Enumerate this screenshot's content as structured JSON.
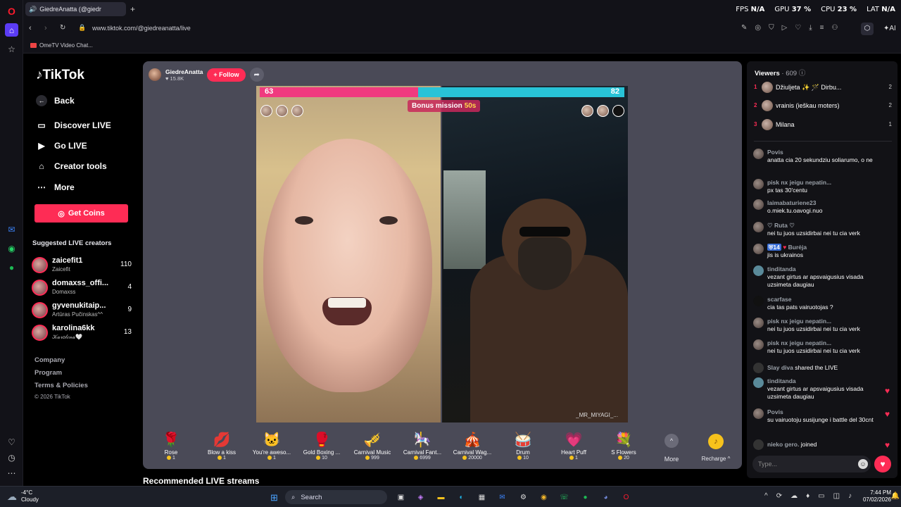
{
  "browser": {
    "tab_title": "GiedreAnatta (@giedr",
    "url": "www.tiktok.com/@giedreanatta/live",
    "bookmark": "OmeTV Video Chat...",
    "hud": {
      "fps_label": "FPS",
      "fps_value": "N/A",
      "gpu_label": "GPU",
      "gpu_value": "37 %",
      "cpu_label": "CPU",
      "cpu_value": "23 %",
      "lat_label": "LAT",
      "lat_value": "N/A"
    },
    "ai_label": "AI"
  },
  "sidebar": {
    "logo": "TikTok",
    "back": "Back",
    "nav": [
      "Discover LIVE",
      "Go LIVE",
      "Creator tools",
      "More"
    ],
    "get_coins": "Get Coins",
    "suggested_title": "Suggested LIVE creators",
    "suggested": [
      {
        "name": "zaicefit1",
        "sub": "Zaicefit",
        "count": "110"
      },
      {
        "name": "domaxss_offi...",
        "sub": "Domaxss",
        "count": "4"
      },
      {
        "name": "gyvenukitaip...",
        "sub": "Artūras Pučinskas^^",
        "count": "9"
      },
      {
        "name": "karolina6kk",
        "sub": "𝒦𝒶𝓇𝑜𝓁𝒾𝓃𝒶🤍",
        "count": "13"
      }
    ],
    "footer": [
      "Company",
      "Program",
      "Terms & Policies",
      "© 2026 TikTok"
    ]
  },
  "live": {
    "host_name": "GiedreAnatta",
    "host_likes": "15.8K",
    "follow": "+ Follow",
    "score_left": "63",
    "score_right": "82",
    "score_left_share": 0.434,
    "bonus_label": "Bonus mission",
    "bonus_time": "50s",
    "video_tag": "_MR_MIYAGI_...",
    "gifts": [
      {
        "name": "Rose",
        "price": "1",
        "icon": "🌹"
      },
      {
        "name": "Blow a kiss",
        "price": "1",
        "icon": "💋"
      },
      {
        "name": "You're aweso...",
        "price": "1",
        "icon": "🐱"
      },
      {
        "name": "Gold Boxing ...",
        "price": "10",
        "icon": "🥊"
      },
      {
        "name": "Carnival Music",
        "price": "999",
        "icon": "🎺"
      },
      {
        "name": "Carnival Fant...",
        "price": "6999",
        "icon": "🎠"
      },
      {
        "name": "Carnival Wag...",
        "price": "20000",
        "icon": "🎪"
      },
      {
        "name": "Drum",
        "price": "10",
        "icon": "🥁"
      },
      {
        "name": "Heart Puff",
        "price": "1",
        "icon": "💗"
      },
      {
        "name": "S Flowers",
        "price": "20",
        "icon": "💐"
      }
    ],
    "more": "More",
    "recharge": "Recharge"
  },
  "recommended": "Recommended LIVE streams",
  "chat": {
    "viewers_label": "Viewers",
    "viewers_count": "· 609",
    "top_viewers": [
      {
        "rank": "1",
        "name": "Džiuljeta ✨ 🪄 Dirbu...",
        "count": "2"
      },
      {
        "rank": "2",
        "name": "vrainis (ieškau moters)",
        "count": "2"
      },
      {
        "rank": "3",
        "name": "Milana",
        "count": "1"
      }
    ],
    "messages": [
      {
        "user": "Povis",
        "text": "anatta cia 20 sekundziu soliarumo, o ne"
      },
      {
        "user": "pisk nx jeigu nepatin...",
        "text": "px tas 30'centu"
      },
      {
        "user": "laimabaturiene23",
        "text": "o.miek.tu.oavogi.nuo"
      },
      {
        "user": "♡ Ruta ♡",
        "text": "nei tu juos uzsidirbai nei tu cia verk"
      },
      {
        "user": "Burėja",
        "badge": "14",
        "text": "jis is ukrainos"
      },
      {
        "user": "tinditanda",
        "text": "vezant girtus ar apsvaigusius visada uzsimeta daugiau"
      },
      {
        "user": "scarfase",
        "text": "cia tas pats vairuotojas ?"
      },
      {
        "user": "pisk nx jeigu nepatin...",
        "text": "nei tu juos uzsidirbai nei tu cia verk"
      },
      {
        "user": "pisk nx jeigu nepatin...",
        "text": "nei tu juos uzsidirbai nei tu cia verk"
      },
      {
        "user": "Slay diva",
        "text": "shared the LIVE"
      },
      {
        "user": "tinditanda",
        "text": "vezant girtus ar apsvaigusius visada uzsimeta daugiau"
      },
      {
        "user": "Povis",
        "text": "su vairuotoju susijunge i battle del 30cnt"
      },
      {
        "user": "nieko gero.",
        "text": "joined"
      }
    ],
    "input_placeholder": "Type..."
  },
  "taskbar": {
    "temp": "-4°C",
    "weather": "Cloudy",
    "search": "Search",
    "time": "7:44 PM",
    "date": "07/02/2026"
  }
}
